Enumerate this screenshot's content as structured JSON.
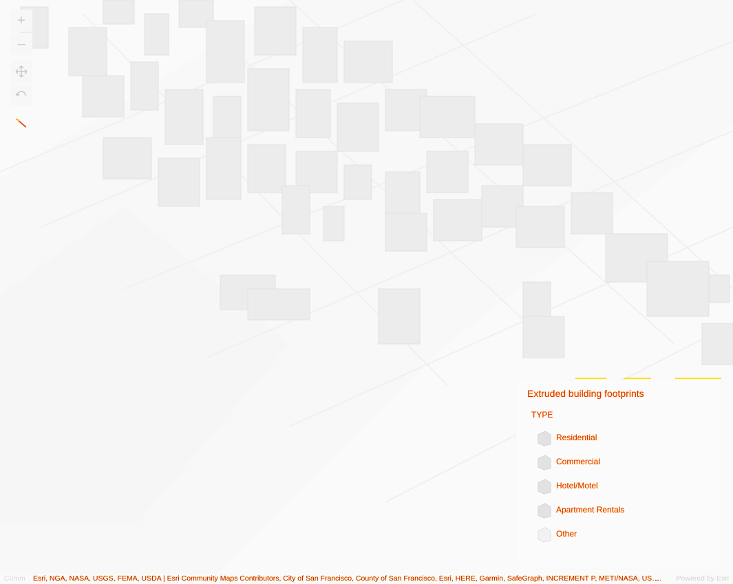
{
  "map": {
    "view": "3D city scene",
    "basemap_color": "#fafafa",
    "building_color": "#ececec"
  },
  "controls": {
    "zoom_in": {
      "label": "+",
      "icon": "plus-icon"
    },
    "zoom_out": {
      "label": "–",
      "icon": "minus-icon"
    },
    "pan": {
      "icon": "pan-arrows-icon"
    },
    "rotate": {
      "icon": "rotate-icon"
    },
    "compass": {
      "icon": "compass-needle-icon"
    }
  },
  "legend": {
    "title": "Extruded building footprints",
    "field": "TYPE",
    "items": [
      {
        "label": "Residential",
        "color": "#e2e2e2"
      },
      {
        "label": "Commercial",
        "color": "#e2e2e2"
      },
      {
        "label": "Hotel/Motel",
        "color": "#e2e2e2"
      },
      {
        "label": "Apartment Rentals",
        "color": "#e2e2e2"
      },
      {
        "label": "Other",
        "color": "#f2f2f2"
      }
    ]
  },
  "attribution": {
    "prefix": "Comm",
    "text": "Esri, NGA, NASA, USGS, FEMA, USDA | Esri Community Maps Contributors, City of San Francisco, County of San Francisco, Esri, HERE, Garmin, SafeGraph, INCREMENT P, METI/NASA, USGS, EPA, NPS, USDA | Esri, HERE, Garmin, FAO, NOAA, USGS, EPA, NPS",
    "ellipsis": "...",
    "powered_by": "Powered by Esri"
  }
}
